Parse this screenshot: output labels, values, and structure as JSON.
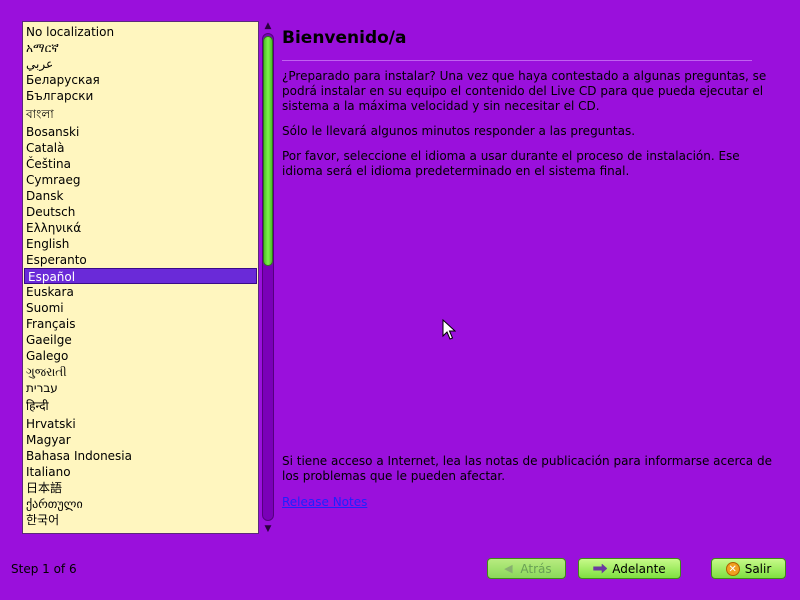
{
  "languages": [
    {
      "label": "No localization"
    },
    {
      "label": "አማርኛ"
    },
    {
      "label": "عربي"
    },
    {
      "label": "Беларуская"
    },
    {
      "label": "Български"
    },
    {
      "label": "বাংলা"
    },
    {
      "label": "Bosanski"
    },
    {
      "label": "Català"
    },
    {
      "label": "Čeština"
    },
    {
      "label": "Cymraeg"
    },
    {
      "label": "Dansk"
    },
    {
      "label": "Deutsch"
    },
    {
      "label": "Ελληνικά"
    },
    {
      "label": "English"
    },
    {
      "label": "Esperanto"
    },
    {
      "label": "Español"
    },
    {
      "label": "Euskara"
    },
    {
      "label": "Suomi"
    },
    {
      "label": "Français"
    },
    {
      "label": "Gaeilge"
    },
    {
      "label": "Galego"
    },
    {
      "label": "ગુજરાતી"
    },
    {
      "label": "עברית"
    },
    {
      "label": "हिन्दी"
    },
    {
      "label": "Hrvatski"
    },
    {
      "label": "Magyar"
    },
    {
      "label": "Bahasa Indonesia"
    },
    {
      "label": "Italiano"
    },
    {
      "label": "日本語"
    },
    {
      "label": "ქართული"
    },
    {
      "label": "한국어"
    }
  ],
  "selected_language": "Español",
  "content": {
    "title": "Bienvenido/a",
    "paragraph1": "¿Preparado para instalar? Una vez que haya contestado a algunas preguntas, se podrá instalar en su equipo el contenido del Live CD para que pueda ejecutar el sistema a la máxima velocidad y sin necesitar el CD.",
    "paragraph2": "Sólo le llevará algunos minutos responder a las preguntas.",
    "paragraph3": "Por favor, seleccione el idioma a usar durante el proceso de instalación. Ese idioma será el idioma predeterminado en el sistema final.",
    "notes_text": "Si tiene acceso a Internet, lea las notas de publicación para informarse acerca de los problemas que le pueden afectar.",
    "notes_link": "Release Notes"
  },
  "footer": {
    "step": "Step 1 of 6",
    "back_label": "Atrás",
    "forward_label": "Adelante",
    "quit_label": "Salir"
  },
  "colors": {
    "background": "#9a10dc",
    "list_background": "#fff6bf",
    "selection": "#6a2ad8",
    "button_green": "#7ee040"
  }
}
